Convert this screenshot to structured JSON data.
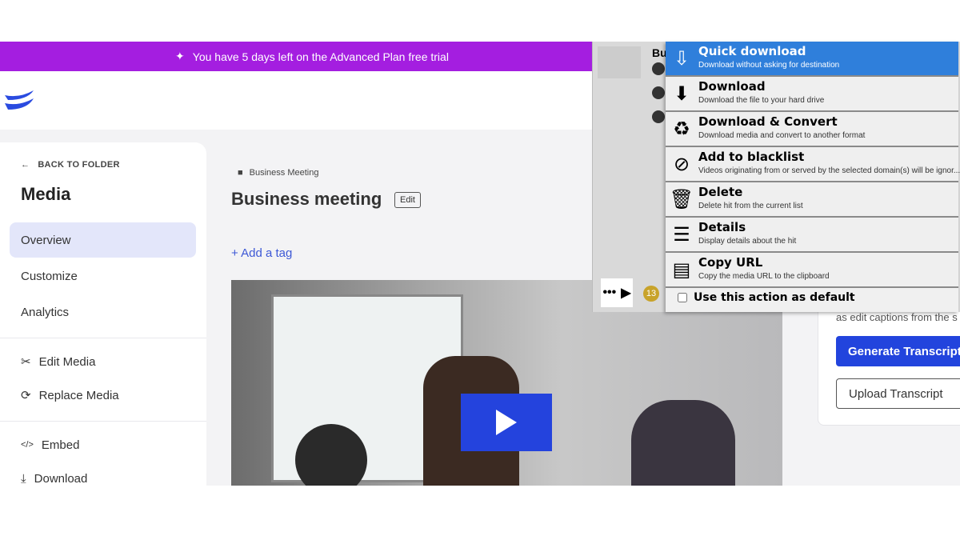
{
  "banner": {
    "text": "You have 5 days left on the Advanced Plan free trial",
    "icon": "sparkle-icon"
  },
  "sidebar": {
    "back": "BACK TO FOLDER",
    "title": "Media",
    "nav": [
      {
        "label": "Overview",
        "active": true
      },
      {
        "label": "Customize"
      },
      {
        "label": "Analytics"
      }
    ],
    "actions": [
      {
        "label": "Edit Media",
        "icon": "scissors-icon"
      },
      {
        "label": "Replace Media",
        "icon": "refresh-icon"
      }
    ],
    "more": [
      {
        "label": "Embed",
        "icon": "code-icon"
      },
      {
        "label": "Download",
        "icon": "download-icon"
      }
    ]
  },
  "main": {
    "breadcrumb": "Business Meeting",
    "title": "Business meeting",
    "edit": "Edit",
    "add_tag": "+ Add a tag"
  },
  "right": {
    "text": "as edit captions from the s",
    "generate": "Generate Transcript",
    "upload": "Upload Transcript"
  },
  "popup": {
    "hit_label": "Bu",
    "count": "13",
    "items": [
      {
        "title": "Quick download",
        "desc": "Download without asking for destination",
        "icon": "lightning-download-icon",
        "selected": true
      },
      {
        "title": "Download",
        "desc": "Download the file to your hard drive",
        "icon": "download-arrow-icon"
      },
      {
        "title": "Download & Convert",
        "desc": "Download media and convert to another format",
        "icon": "download-convert-icon"
      },
      {
        "title": "Add to blacklist",
        "desc": "Videos originating from or served by the selected domain(s) will be ignor...",
        "icon": "blacklist-icon"
      },
      {
        "title": "Delete",
        "desc": "Delete hit from the current list",
        "icon": "trash-icon"
      },
      {
        "title": "Details",
        "desc": "Display details about the hit",
        "icon": "details-icon"
      },
      {
        "title": "Copy URL",
        "desc": "Copy the media URL to the clipboard",
        "icon": "copy-url-icon"
      }
    ],
    "default_label": "Use this action as default"
  },
  "colors": {
    "banner": "#a41ee0",
    "accent": "#2244dd",
    "menu_selected": "#2f7fdb"
  }
}
